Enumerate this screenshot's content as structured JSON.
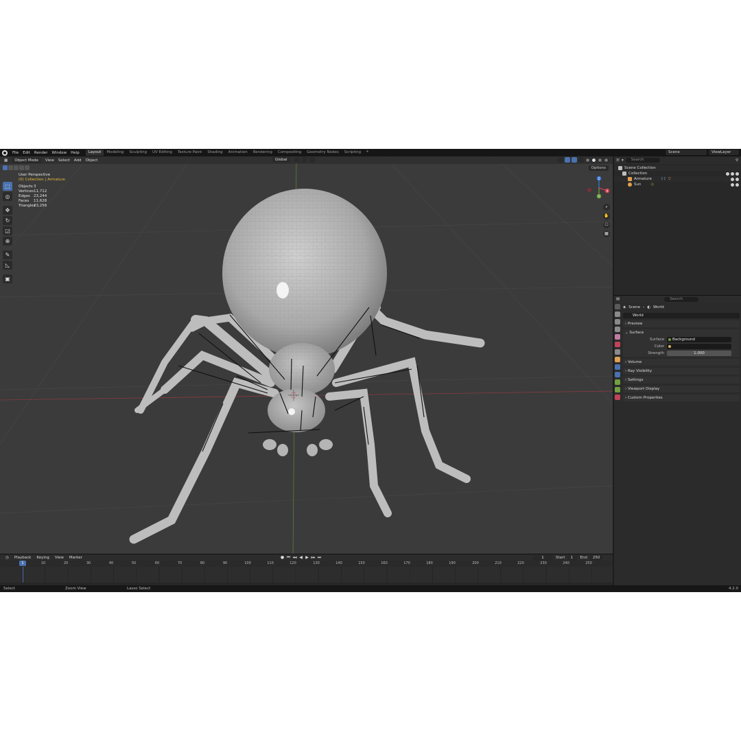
{
  "topbar": {
    "menus": [
      "File",
      "Edit",
      "Render",
      "Window",
      "Help"
    ],
    "workspaces": [
      "Layout",
      "Modeling",
      "Sculpting",
      "UV Editing",
      "Texture Paint",
      "Shading",
      "Animation",
      "Rendering",
      "Compositing",
      "Geometry Nodes",
      "Scripting"
    ],
    "active_workspace": "Layout",
    "add_tab": "+",
    "scene": "Scene",
    "view_layer": "ViewLayer"
  },
  "viewport": {
    "mode": "Object Mode",
    "menus": [
      "View",
      "Select",
      "Add",
      "Object"
    ],
    "transform_orientation": "Global",
    "options_label": "Options",
    "view_name": "User Perspective",
    "context": "(0) Collection | Armature",
    "stats": [
      {
        "label": "Objects",
        "value": "3"
      },
      {
        "label": "Vertices",
        "value": "11,712"
      },
      {
        "label": "Edges",
        "value": "23,244"
      },
      {
        "label": "Faces",
        "value": "11,628"
      },
      {
        "label": "Triangles",
        "value": "23,256"
      }
    ],
    "gizmo_axes": {
      "x": "X",
      "y": "Y",
      "z": "Z"
    }
  },
  "timeline": {
    "menus": [
      "Playback",
      "Keying",
      "View",
      "Marker"
    ],
    "current_frame": "1",
    "start_label": "Start",
    "start": "1",
    "end_label": "End",
    "end": "250",
    "ruler": [
      "1",
      "10",
      "20",
      "30",
      "40",
      "50",
      "60",
      "70",
      "80",
      "90",
      "100",
      "110",
      "120",
      "130",
      "140",
      "150",
      "160",
      "170",
      "180",
      "190",
      "200",
      "210",
      "220",
      "230",
      "240",
      "250"
    ]
  },
  "statusbar": {
    "select": "Select",
    "zoom": "Zoom View",
    "lasso": "Lasso Select",
    "version": "4.2.0"
  },
  "outliner": {
    "search_placeholder": "Search",
    "rows": [
      {
        "label": "Scene Collection",
        "color": "#bdbdbd"
      },
      {
        "label": "Collection",
        "color": "#bdbdbd"
      },
      {
        "label": "Armature",
        "color": "#e0a050"
      },
      {
        "label": "Sun",
        "color": "#e0a050"
      }
    ]
  },
  "properties": {
    "search_placeholder": "Search",
    "breadcrumb": [
      "Scene",
      "World"
    ],
    "world_name": "World",
    "panels": {
      "preview": "Preview",
      "surface": "Surface",
      "volume": "Volume",
      "ray_visibility": "Ray Visibility",
      "settings": "Settings",
      "viewport_display": "Viewport Display",
      "custom_properties": "Custom Properties"
    },
    "surface_label": "Surface",
    "surface_value": "Background",
    "color_label": "Color",
    "strength_label": "Strength",
    "strength_value": "1.000"
  },
  "colors": {
    "accent": "#4a72b0",
    "viewport_bg": "#3b3b3b",
    "context_text": "#e8b93c",
    "axis_x": "#d04050",
    "axis_y": "#70a040",
    "axis_z": "#3a78d8"
  }
}
